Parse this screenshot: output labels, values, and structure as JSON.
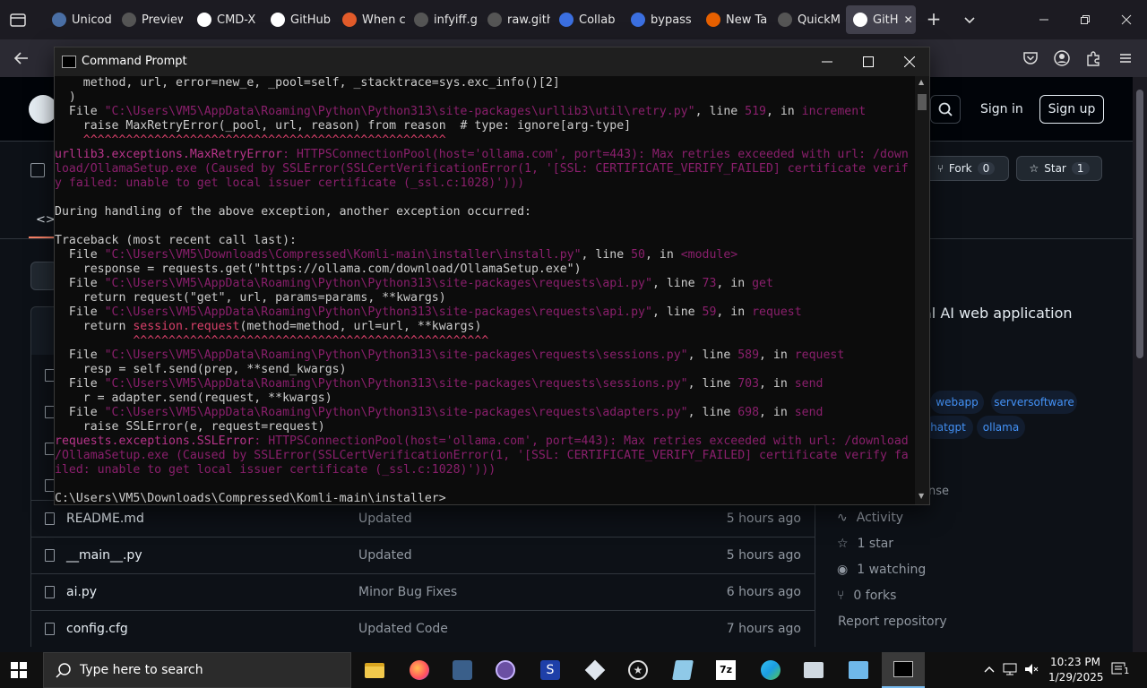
{
  "browser": {
    "tabs": [
      {
        "label": "Unicod",
        "color": "#4a6fa5"
      },
      {
        "label": "Preview Co",
        "color": "#555"
      },
      {
        "label": "CMD-X",
        "color": "#ffffff"
      },
      {
        "label": "GitHub",
        "color": "#ffffff"
      },
      {
        "label": "When c",
        "color": "#e25b2a"
      },
      {
        "label": "infyiff.githu",
        "color": "#555"
      },
      {
        "label": "raw.githubu",
        "color": "#555"
      },
      {
        "label": "Collab",
        "color": "#3b6fe0"
      },
      {
        "label": "bypass",
        "color": "#3b6fe0"
      },
      {
        "label": "New Ta",
        "color": "#e66000"
      },
      {
        "label": "QuickMash",
        "color": "#555"
      },
      {
        "label": "GitH",
        "color": "#ffffff"
      }
    ],
    "close_glyph": "✕",
    "new_tab_glyph": "+"
  },
  "github": {
    "sign_in": "Sign in",
    "sign_up": "Sign up",
    "fork_label": "Fork",
    "fork_count": "0",
    "star_label": "Star",
    "star_count": "1",
    "about_partial": "al AI web application",
    "topics": [
      "webapp",
      "serversoftware",
      "hatgpt",
      "ollama"
    ],
    "license_partial": "nse",
    "files": [
      {
        "name": "README.md",
        "commit": "Updated",
        "time": "5 hours ago"
      },
      {
        "name": "__main__.py",
        "commit": "Updated",
        "time": "5 hours ago"
      },
      {
        "name": "ai.py",
        "commit": "Minor Bug Fixes",
        "time": "6 hours ago"
      },
      {
        "name": "config.cfg",
        "commit": "Updated Code",
        "time": "7 hours ago"
      }
    ],
    "sidebar": {
      "activity": "Activity",
      "stars": "1 star",
      "watching": "1 watching",
      "forks": "0 forks",
      "report": "Report repository"
    }
  },
  "cmd": {
    "title": "Command Prompt",
    "lines": [
      [
        [
          "    method, url, error=new_e, _pool=self, _stacktrace=sys.exc_info()[2]",
          ""
        ]
      ],
      [
        [
          "  )",
          ""
        ]
      ],
      [
        [
          "  File ",
          ""
        ],
        [
          "\"C:\\Users\\VM5\\AppData\\Roaming\\Python\\Python313\\site-packages\\urllib3\\util\\retry.py\"",
          "dim"
        ],
        [
          ", line ",
          ""
        ],
        [
          "519",
          "dim"
        ],
        [
          ", in ",
          ""
        ],
        [
          "increment",
          "dim"
        ]
      ],
      [
        [
          "    raise MaxRetryError(_pool, url, reason) from reason  # type: ignore[arg-type]",
          ""
        ]
      ],
      [
        [
          "    ^^^^^^^^^^^^^^^^^^^^^^^^^^^^^^^^^^^^^^^^^^^^^^^^^^^",
          "red"
        ]
      ],
      [
        [
          "urllib3.exceptions.MaxRetryError",
          "err"
        ],
        [
          ": HTTPSConnectionPool(host='ollama.com', port=443): Max retries exceeded with url: /down",
          "dim"
        ]
      ],
      [
        [
          "load/OllamaSetup.exe (Caused by SSLError(SSLCertVerificationError(1, '[SSL: CERTIFICATE_VERIFY_FAILED] certificate verif",
          "dim"
        ]
      ],
      [
        [
          "y failed: unable to get local issuer certificate (_ssl.c:1028)')))",
          "dim"
        ]
      ],
      [
        [
          "",
          ""
        ]
      ],
      [
        [
          "During handling of the above exception, another exception occurred:",
          ""
        ]
      ],
      [
        [
          "",
          ""
        ]
      ],
      [
        [
          "Traceback (most recent call last):",
          ""
        ]
      ],
      [
        [
          "  File ",
          ""
        ],
        [
          "\"C:\\Users\\VM5\\Downloads\\Compressed\\Komli-main\\installer\\install.py\"",
          "dim"
        ],
        [
          ", line ",
          ""
        ],
        [
          "50",
          "dim"
        ],
        [
          ", in ",
          ""
        ],
        [
          "<module>",
          "dim"
        ]
      ],
      [
        [
          "    response = requests.get(\"https://ollama.com/download/OllamaSetup.exe\")",
          ""
        ]
      ],
      [
        [
          "  File ",
          ""
        ],
        [
          "\"C:\\Users\\VM5\\AppData\\Roaming\\Python\\Python313\\site-packages\\requests\\api.py\"",
          "dim"
        ],
        [
          ", line ",
          ""
        ],
        [
          "73",
          "dim"
        ],
        [
          ", in ",
          ""
        ],
        [
          "get",
          "dim"
        ]
      ],
      [
        [
          "    return request(\"get\", url, params=params, **kwargs)",
          ""
        ]
      ],
      [
        [
          "  File ",
          ""
        ],
        [
          "\"C:\\Users\\VM5\\AppData\\Roaming\\Python\\Python313\\site-packages\\requests\\api.py\"",
          "dim"
        ],
        [
          ", line ",
          ""
        ],
        [
          "59",
          "dim"
        ],
        [
          ", in ",
          ""
        ],
        [
          "request",
          "dim"
        ]
      ],
      [
        [
          "    return ",
          ""
        ],
        [
          "session.request",
          "red"
        ],
        [
          "(method=method, url=url, **kwargs)",
          ""
        ]
      ],
      [
        [
          "           ^^^^^^^^^^^^^^^^^^^^^^^^^^^^^^^^^^^^^^^^^^^^^^^^^^",
          "red"
        ]
      ],
      [
        [
          "  File ",
          ""
        ],
        [
          "\"C:\\Users\\VM5\\AppData\\Roaming\\Python\\Python313\\site-packages\\requests\\sessions.py\"",
          "dim"
        ],
        [
          ", line ",
          ""
        ],
        [
          "589",
          "dim"
        ],
        [
          ", in ",
          ""
        ],
        [
          "request",
          "dim"
        ]
      ],
      [
        [
          "    resp = self.send(prep, **send_kwargs)",
          ""
        ]
      ],
      [
        [
          "  File ",
          ""
        ],
        [
          "\"C:\\Users\\VM5\\AppData\\Roaming\\Python\\Python313\\site-packages\\requests\\sessions.py\"",
          "dim"
        ],
        [
          ", line ",
          ""
        ],
        [
          "703",
          "dim"
        ],
        [
          ", in ",
          ""
        ],
        [
          "send",
          "dim"
        ]
      ],
      [
        [
          "    r = adapter.send(request, **kwargs)",
          ""
        ]
      ],
      [
        [
          "  File ",
          ""
        ],
        [
          "\"C:\\Users\\VM5\\AppData\\Roaming\\Python\\Python313\\site-packages\\requests\\adapters.py\"",
          "dim"
        ],
        [
          ", line ",
          ""
        ],
        [
          "698",
          "dim"
        ],
        [
          ", in ",
          ""
        ],
        [
          "send",
          "dim"
        ]
      ],
      [
        [
          "    raise SSLError(e, request=request)",
          ""
        ]
      ],
      [
        [
          "requests.exceptions.SSLError",
          "err"
        ],
        [
          ": HTTPSConnectionPool(host='ollama.com', port=443): Max retries exceeded with url: /download",
          "dim"
        ]
      ],
      [
        [
          "/OllamaSetup.exe (Caused by SSLError(SSLCertVerificationError(1, '[SSL: CERTIFICATE_VERIFY_FAILED] certificate verify fa",
          "dim"
        ]
      ],
      [
        [
          "iled: unable to get local issuer certificate (_ssl.c:1028)')))",
          "dim"
        ]
      ],
      [
        [
          "",
          ""
        ]
      ],
      [
        [
          "C:\\Users\\VM5\\Downloads\\Compressed\\Komli-main\\installer>",
          ""
        ]
      ]
    ]
  },
  "taskbar": {
    "search_placeholder": "Type here to search",
    "time": "10:23 PM",
    "date": "1/29/2025",
    "notification_count": "1"
  }
}
